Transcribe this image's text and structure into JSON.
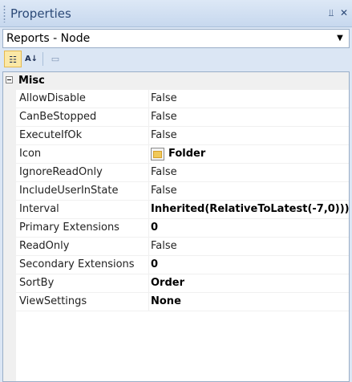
{
  "panel": {
    "title": "Properties",
    "pin_glyph": "⫫",
    "close_glyph": "✕"
  },
  "selector": {
    "value": "Reports - Node",
    "arrow_glyph": "▼"
  },
  "toolbar": {
    "categorized_glyph": "☷",
    "alphabetical_glyph": "A↓",
    "pages_glyph": "▭",
    "active": "categorized"
  },
  "grid": {
    "category": {
      "label": "Misc",
      "expanded": true
    },
    "properties": [
      {
        "name": "AllowDisable",
        "value": "False",
        "bold": false
      },
      {
        "name": "CanBeStopped",
        "value": "False",
        "bold": false
      },
      {
        "name": "ExecuteIfOk",
        "value": "False",
        "bold": false
      },
      {
        "name": "Icon",
        "value": "Folder",
        "bold": true,
        "icon": "folder-icon"
      },
      {
        "name": "IgnoreReadOnly",
        "value": "False",
        "bold": false
      },
      {
        "name": "IncludeUserInState",
        "value": "False",
        "bold": false
      },
      {
        "name": "Interval",
        "value": "Inherited(RelativeToLatest(-7,0)))",
        "bold": true
      },
      {
        "name": "Primary Extensions",
        "value": "0",
        "bold": true
      },
      {
        "name": "ReadOnly",
        "value": "False",
        "bold": false
      },
      {
        "name": "Secondary Extensions",
        "value": "0",
        "bold": true
      },
      {
        "name": "SortBy",
        "value": "Order",
        "bold": true
      },
      {
        "name": "ViewSettings",
        "value": "None",
        "bold": true
      }
    ]
  }
}
